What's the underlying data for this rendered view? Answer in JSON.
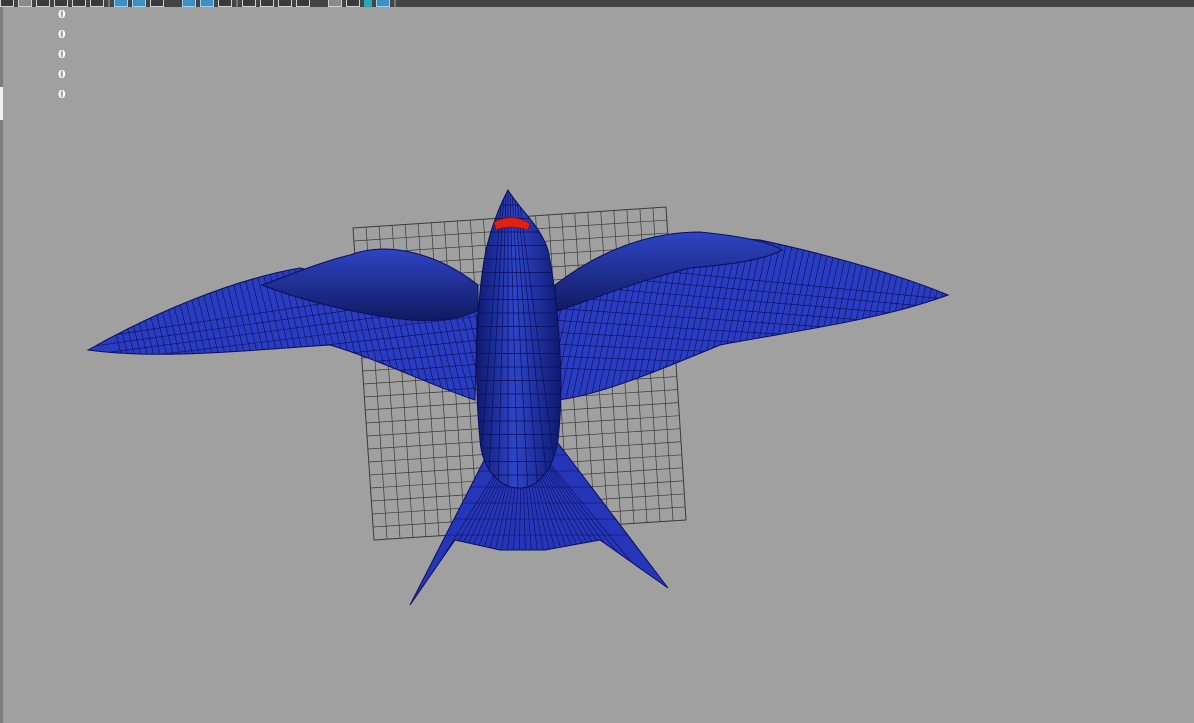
{
  "viewport": {
    "background": "#a0a0a0",
    "hud_values": [
      "0",
      "0",
      "0",
      "0",
      "0"
    ],
    "model": {
      "name": "bird-model",
      "body_color": "#1e2ea8",
      "wireframe_color": "#0a0f5a",
      "highlight_color": "#e02010",
      "grid_color": "#3a3a3a"
    }
  },
  "toolbar": {
    "icons": [
      "select-icon",
      "lasso-icon",
      "paint-icon",
      "move-icon",
      "rotate-icon",
      "scale-icon",
      "camera-icon",
      "shading-icon",
      "wireframe-icon",
      "textured-icon",
      "lighting-icon",
      "shadow-icon",
      "isolate-icon",
      "xray-icon",
      "grid-icon",
      "frame-icon"
    ]
  }
}
